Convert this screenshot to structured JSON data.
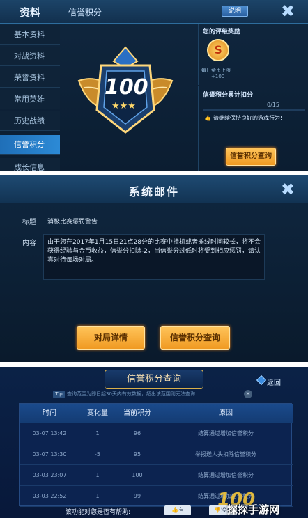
{
  "panel1": {
    "header_left": "资料",
    "header_title": "信誉积分",
    "header_button": "说明",
    "close": "✖",
    "sidebar": [
      "基本资料",
      "对战资料",
      "荣誉资料",
      "常用英雄",
      "历史战绩",
      "信誉积分",
      "成长信息"
    ],
    "active_index": 5,
    "score": "100",
    "stars": "★★★",
    "reward_title": "您的评级奖励",
    "reward_icon_letter": "S",
    "reward_sub": "每日金币上限",
    "reward_value": "+100",
    "deduct_title": "信誉积分累计扣分",
    "deduct_frac": "0/15",
    "deduct_tip": "请继续保持良好的游戏行为!",
    "query_button": "信誉积分查询"
  },
  "panel2": {
    "title": "系统邮件",
    "close": "✖",
    "subject_label": "标题",
    "subject": "消极比赛惩罚警告",
    "content_label": "内容",
    "content": "由于您在2017年1月15日21点28分的比赛中挂机或者摊线时间较长，将不会获得经验与金币收益，信誉分扣除-2，当信誉分过低时将受到相应惩罚，请认真对待每场对局。",
    "btn_detail": "对局详情",
    "btn_query": "信誉积分查询"
  },
  "panel3": {
    "title": "信誉积分查询",
    "back": "返回",
    "tip_badge": "Tip",
    "tip": "查询范围为即日起30天内有效数据，超出该范围则无法查询",
    "tip_close": "✕",
    "headers": [
      "时间",
      "变化量",
      "当前积分",
      "原因"
    ],
    "rows": [
      [
        "03-07  13:42",
        "1",
        "96",
        "结算通过增加信誉积分"
      ],
      [
        "03-07  13:30",
        "-5",
        "95",
        "举报送人头扣除信誉积分"
      ],
      [
        "03-03  23:07",
        "1",
        "100",
        "结算通过增加信誉积分"
      ],
      [
        "03-03  22:52",
        "1",
        "99",
        "结算通过增加信誉积分"
      ]
    ],
    "help_text": "该功能对您是否有帮助:",
    "help_yes": "有",
    "help_no": "没有",
    "watermark": "探探手游网"
  },
  "colors": {
    "gold": "#f09a22",
    "accent_blue": "#2c8ad6",
    "panel_bg": "#0b1d31"
  }
}
